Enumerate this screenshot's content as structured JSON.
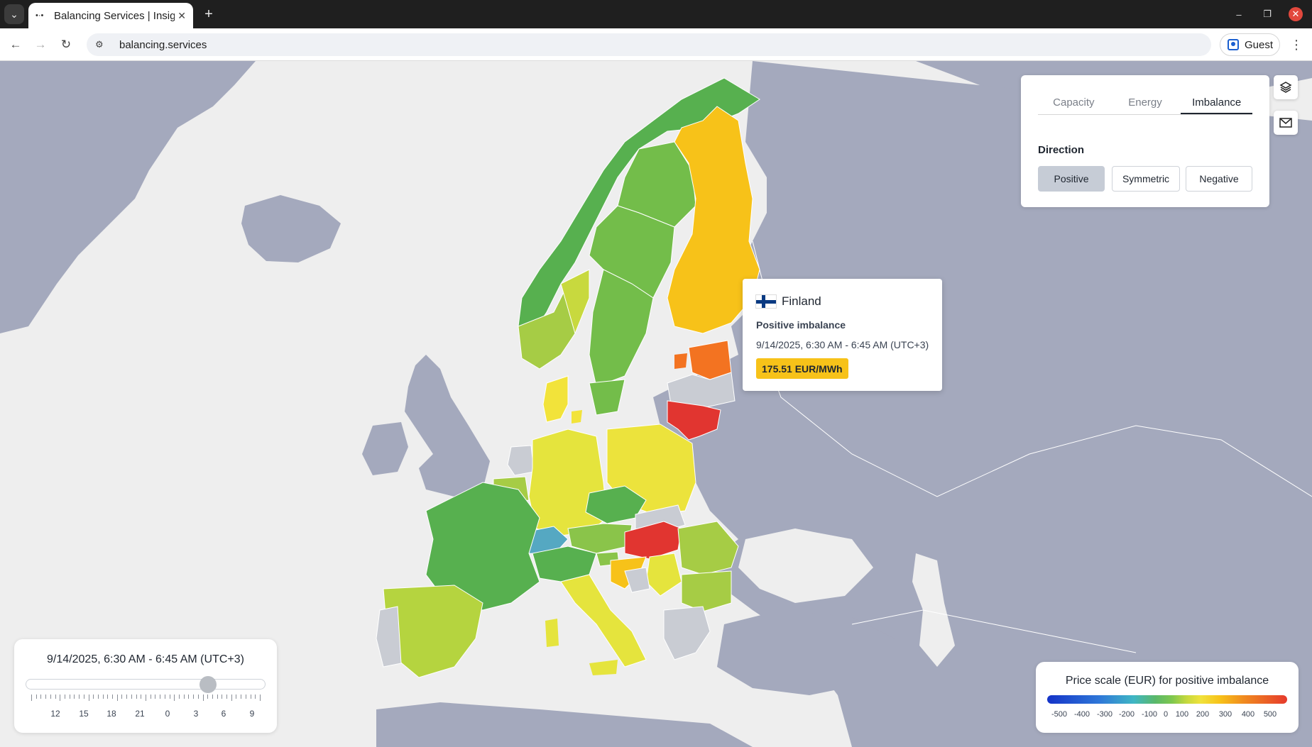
{
  "browser": {
    "tab_title": "Balancing Services | Insig",
    "url": "balancing.services",
    "profile_label": "Guest"
  },
  "panel": {
    "tabs": [
      {
        "label": "Capacity",
        "active": false
      },
      {
        "label": "Energy",
        "active": false
      },
      {
        "label": "Imbalance",
        "active": true
      }
    ],
    "direction_label": "Direction",
    "direction_options": [
      {
        "label": "Positive",
        "active": true
      },
      {
        "label": "Symmetric",
        "active": false
      },
      {
        "label": "Negative",
        "active": false
      }
    ]
  },
  "tooltip": {
    "country": "Finland",
    "title": "Positive imbalance",
    "time": "9/14/2025, 6:30 AM - 6:45 AM (UTC+3)",
    "value": "175.51 EUR/MWh"
  },
  "time_slider": {
    "label": "9/14/2025, 6:30 AM - 6:45 AM (UTC+3)",
    "tick_labels": [
      "12",
      "15",
      "18",
      "21",
      "0",
      "3",
      "6",
      "9"
    ],
    "position_fraction": 0.76
  },
  "legend": {
    "title": "Price scale (EUR) for positive imbalance",
    "labels": [
      "-500",
      "-400",
      "-300",
      "-200",
      "-100",
      "0",
      "100",
      "200",
      "300",
      "400",
      "500"
    ]
  },
  "icons": {
    "layers": "layers-icon",
    "mail": "mail-icon",
    "flag": "finland-flag-icon"
  },
  "colors": {
    "sea": "#eeeeee",
    "land_gray": "#a4a9bd",
    "no_data": "#c9ccd3"
  }
}
